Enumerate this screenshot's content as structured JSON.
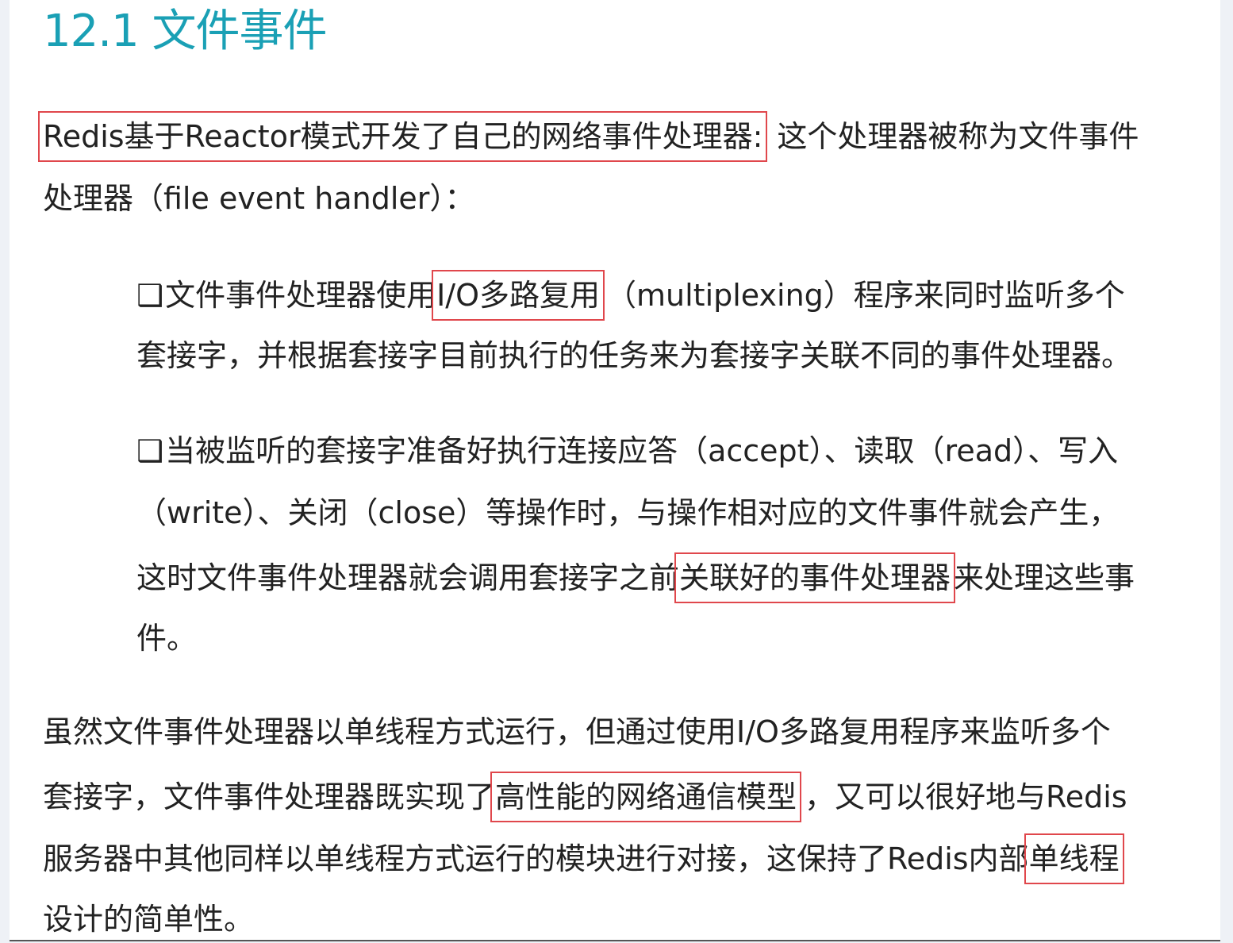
{
  "heading": "12.1 文件事件",
  "para1": {
    "line1_highlight": "Redis基于Reactor模式开发了自己的网络事件处理器:",
    "line1_rest": "这个处理器被称为文件事件",
    "line2": "处理器（file event handler）："
  },
  "bullet1": {
    "marker": "❑",
    "line1_before": "文件事件处理器使用",
    "line1_highlight": "I/O多路复用",
    "line1_after": "（multiplexing）程序来同时监听多个",
    "line2": "套接字，并根据套接字目前执行的任务来为套接字关联不同的事件处理器。"
  },
  "bullet2": {
    "marker": "❑",
    "line1": "当被监听的套接字准备好执行连接应答（accept）、读取（read）、写入",
    "line2": "（write）、关闭（close）等操作时，与操作相对应的文件事件就会产生，",
    "line3_before": "这时文件事件处理器就会调用套接字之前",
    "line3_highlight": "关联好的事件处理器",
    "line3_after": "来处理这些事",
    "line4": "件。"
  },
  "para2": {
    "line1": "虽然文件事件处理器以单线程方式运行，但通过使用I/O多路复用程序来监听多个",
    "line2_before": "套接字，文件事件处理器既实现了",
    "line2_highlight": "高性能的网络通信模型",
    "line2_after": "，又可以很好地与Redis",
    "line3_before": "服务器中其他同样以单线程方式运行的模块进行对接，这保持了Redis内部",
    "line3_highlight": "单线程",
    "line4": "设计的简单性。"
  },
  "colors": {
    "heading": "#1aa0b5",
    "highlight_border": "#e0474c",
    "text": "#222222",
    "background": "#ffffff"
  }
}
